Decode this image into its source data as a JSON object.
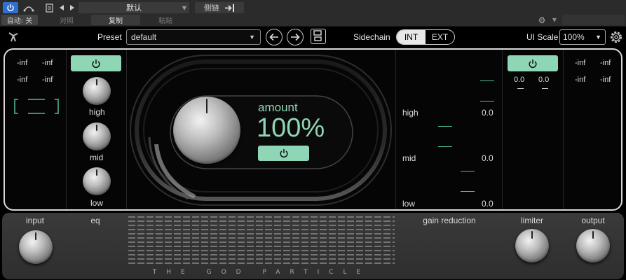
{
  "host": {
    "auto_label": "自动: 关",
    "preset_name": "默认",
    "compare_label": "对照",
    "copy_label": "复制",
    "paste_label": "粘贴",
    "sidechain_label": "侧链"
  },
  "header": {
    "preset_label": "Preset",
    "preset_value": "default",
    "sidechain_label": "Sidechain",
    "sidechain_int": "INT",
    "sidechain_ext": "EXT",
    "ui_scale_label": "UI Scale",
    "ui_scale_value": "100%"
  },
  "input_meter": {
    "peak_l": "-inf",
    "peak_r": "-inf",
    "rms_l": "-inf",
    "rms_r": "-inf"
  },
  "eq": {
    "bands": [
      "high",
      "mid",
      "low"
    ]
  },
  "center": {
    "amount_label": "amount",
    "amount_value": "100%"
  },
  "gain_reduction": {
    "bands": [
      {
        "name": "high",
        "value": "0.0"
      },
      {
        "name": "mid",
        "value": "0.0"
      },
      {
        "name": "low",
        "value": "0.0"
      }
    ]
  },
  "limiter": {
    "value_l": "0.0",
    "value_r": "0.0"
  },
  "output_meter": {
    "peak_l": "-inf",
    "peak_r": "-inf",
    "rms_l": "-inf",
    "rms_r": "-inf"
  },
  "bottom": {
    "input_label": "input",
    "eq_label": "eq",
    "gain_reduction_label": "gain reduction",
    "limiter_label": "limiter",
    "output_label": "output",
    "brand": "THE GOD PARTICLE"
  },
  "colors": {
    "accent": "#8fd6b6",
    "bracket": "#4ec08f",
    "host_power": "#2f6fd0"
  }
}
